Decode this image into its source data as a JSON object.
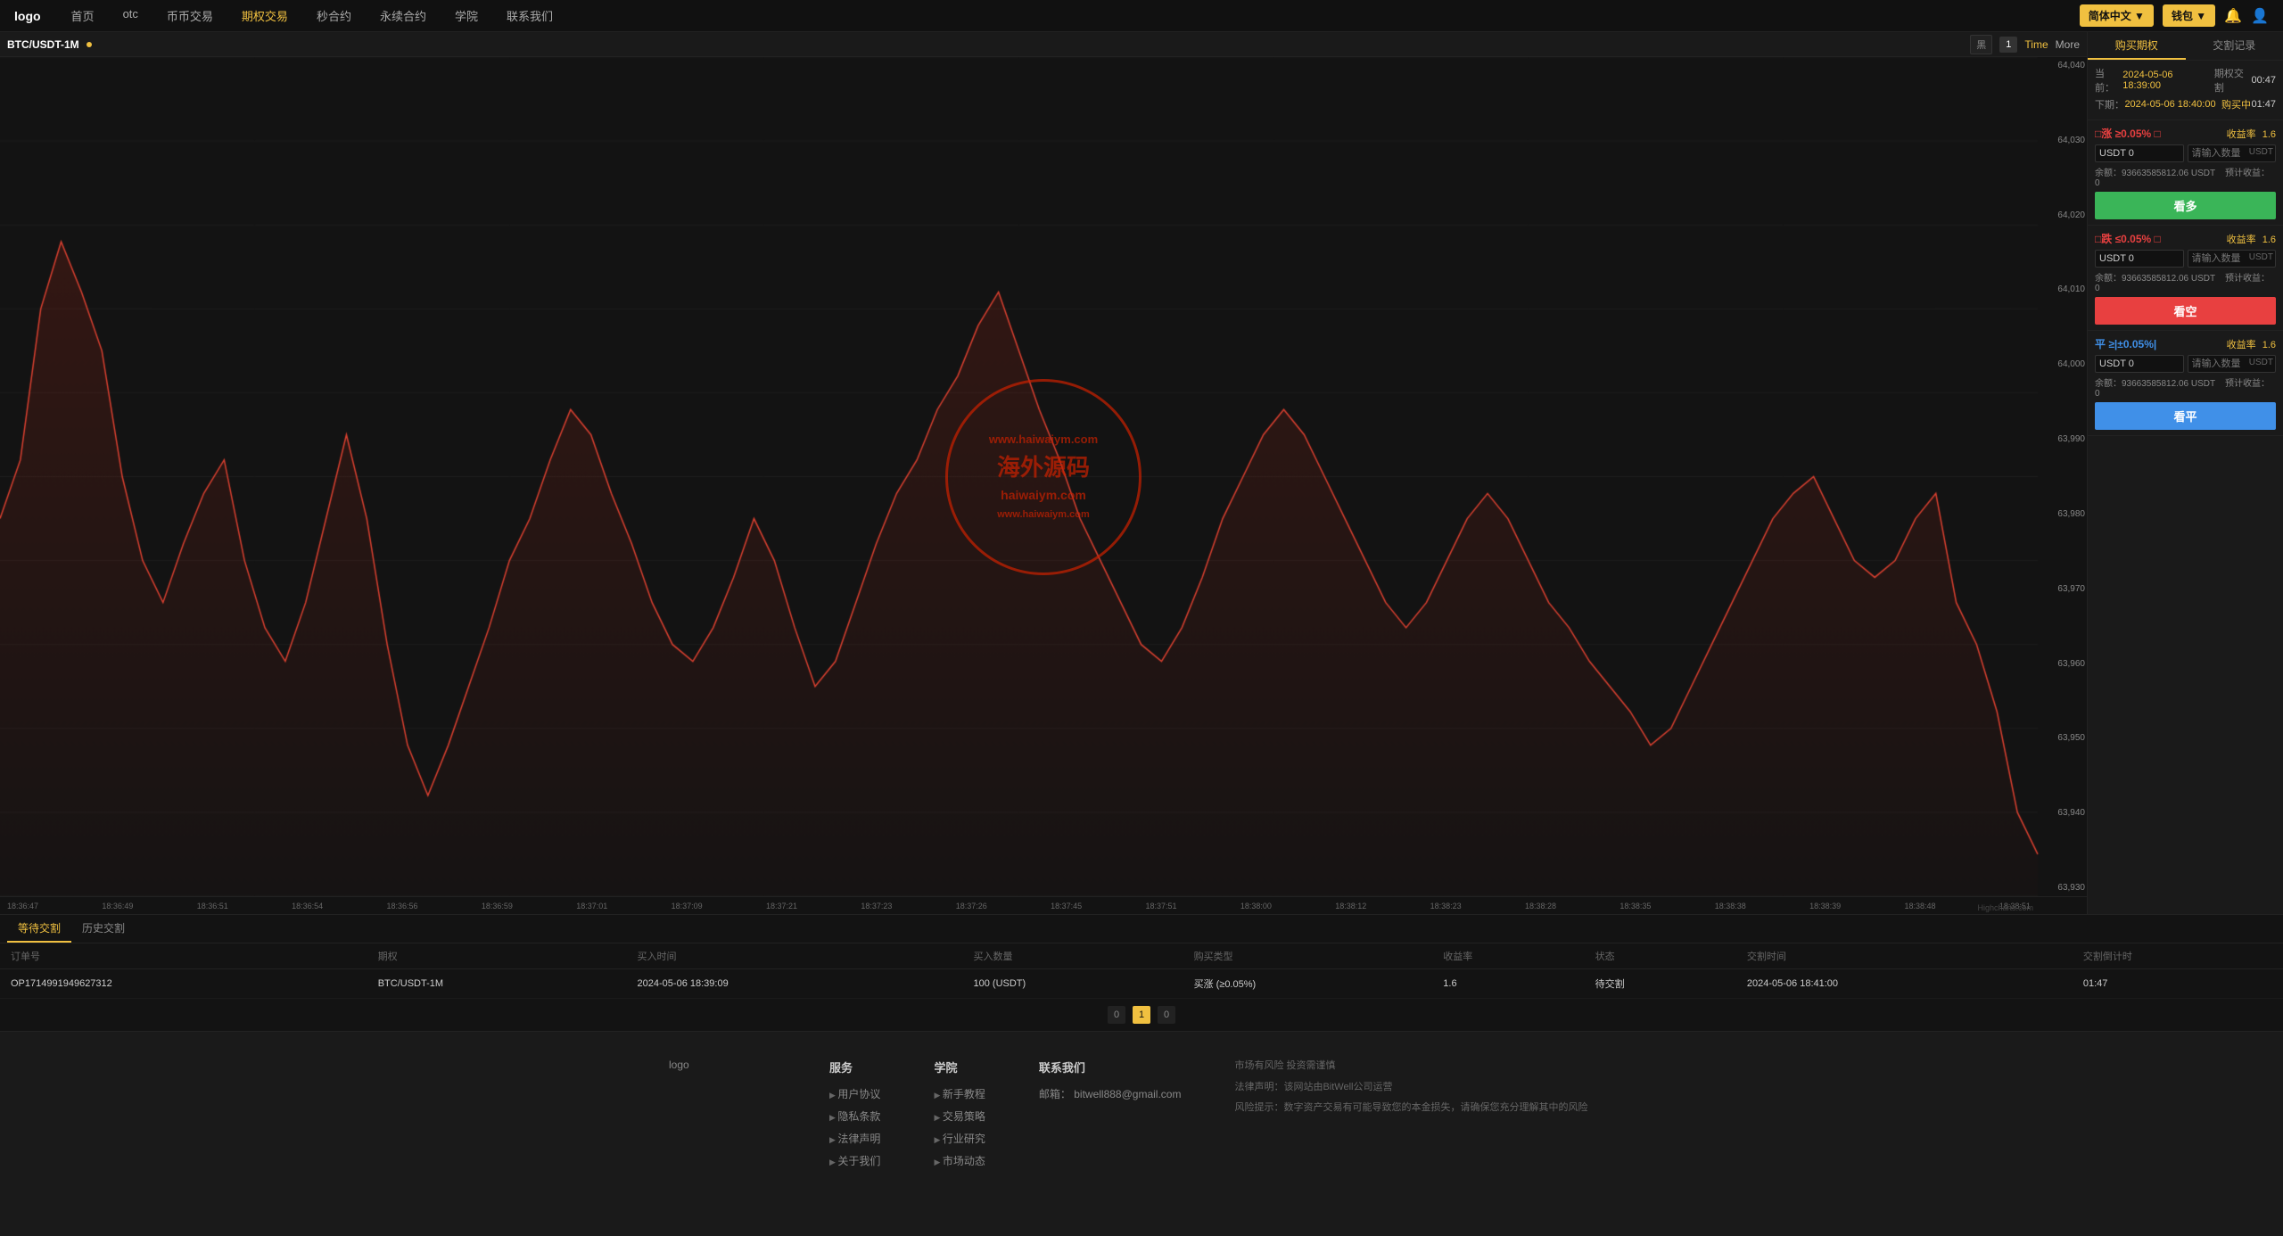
{
  "nav": {
    "logo": "logo",
    "items": [
      {
        "label": "首页",
        "id": "home"
      },
      {
        "label": "otc",
        "id": "otc"
      },
      {
        "label": "币币交易",
        "id": "spot"
      },
      {
        "label": "期权交易",
        "id": "options",
        "active": true
      },
      {
        "label": "秒合约",
        "id": "second"
      },
      {
        "label": "永续合约",
        "id": "perpetual"
      },
      {
        "label": "学院",
        "id": "academy"
      },
      {
        "label": "联系我们",
        "id": "contact"
      }
    ],
    "lang_btn": "简体中文 ▼",
    "wallet_btn": "钱包 ▼"
  },
  "chart": {
    "symbol": "BTC/USDT-1M",
    "badge": "",
    "view_black": "黑",
    "view_num": "1",
    "time_btn": "Time",
    "more_btn": "More",
    "y_labels": [
      "64,040",
      "64,030",
      "64,020",
      "64,010",
      "64,000",
      "63,990",
      "63,980",
      "63,970",
      "63,960",
      "63,950",
      "63,940",
      "63,930"
    ],
    "x_labels": [
      "18:36:47",
      "18:36:49",
      "18:36:51",
      "18:36:54",
      "18:36:56",
      "18:36:59",
      "18:37:01",
      "18:37:09",
      "18:37:21",
      "18:37:23",
      "18:37:26",
      "18:37:45",
      "18:37:51",
      "18:38:00",
      "18:38:12",
      "18:38:23",
      "18:38:28",
      "18:38:35",
      "18:38:38",
      "18:38:39",
      "18:38:48",
      "18:38:51"
    ],
    "credit": "Highcharts.com",
    "watermark": {
      "top": "www.haiwaiym.com",
      "main": "海外源码",
      "url": "haiwaiym.com",
      "bottom": "www.haiwaiym.com"
    }
  },
  "right_panel": {
    "tab_buy": "购买期权",
    "tab_history": "交割记录",
    "current_label": "当前：",
    "current_time": "2024-05-06 18:39:00",
    "current_period_label": "期权交割",
    "current_period_val": "00:47",
    "next_label": "下期：",
    "next_time": "2024-05-06 18:40:00",
    "next_status": "购买中",
    "next_val": "01:47",
    "rise_label": "□涨 ≥0.05% □",
    "rise_yield_label": "收益率",
    "rise_yield_val": "1.6",
    "rise_amount_placeholder": "请输入数量",
    "rise_unit": "USDT",
    "rise_balance_label": "余额：93663585812.06 USDT",
    "rise_calc_label": "预计收益：",
    "rise_calc_val": "0",
    "rise_btn": "看多",
    "fall_label": "□跌 ≤0.05% □",
    "fall_yield_label": "收益率",
    "fall_yield_val": "1.6",
    "fall_amount_placeholder": "请输入数量",
    "fall_unit": "USDT",
    "fall_balance_label": "余额：93663585812.06 USDT",
    "fall_calc_label": "预计收益：",
    "fall_calc_val": "0",
    "fall_btn": "看空",
    "flat_label": "平 ≥|±0.05%|",
    "flat_yield_label": "收益率",
    "flat_yield_val": "1.6",
    "flat_amount_placeholder": "请输入数量",
    "flat_unit": "USDT",
    "flat_balance_label": "余额：93663585812.06 USDT",
    "flat_calc_label": "预计收益：",
    "flat_calc_val": "0",
    "flat_btn": "看平"
  },
  "orders": {
    "tab_pending": "等待交割",
    "tab_history": "历史交割",
    "columns": [
      "订单号",
      "期权",
      "买入时间",
      "买入数量",
      "购买类型",
      "收益率",
      "状态",
      "交割时间",
      "交割倒计时"
    ],
    "rows": [
      {
        "order_id": "OP1714991949627312",
        "period": "BTC/USDT-1M",
        "buy_time": "2024-05-06 18:39:09",
        "amount": "100 (USDT)",
        "type": "买涨 (≥0.05%)",
        "yield_rate": "1.6",
        "status": "待交割",
        "delivery_time": "2024-05-06 18:41:00",
        "countdown": "01:47"
      }
    ],
    "pagination": [
      "0",
      "1",
      "0"
    ]
  },
  "footer": {
    "logo_text": "logo",
    "service_title": "服务",
    "service_items": [
      "用户协议",
      "隐私条款",
      "法律声明",
      "关于我们"
    ],
    "academy_title": "学院",
    "academy_items": [
      "新手教程",
      "交易策略",
      "行业研究",
      "市场动态"
    ],
    "contact_title": "联系我们",
    "email_label": "邮箱：",
    "email_val": "bitwell888@gmail.com",
    "risk_title": "市场有风险 投资需谨慎",
    "legal_notice": "法律声明：该网站由BitWell公司运营",
    "risk_notice": "风险提示：数字资产交易有可能导致您的本金损失，请确保您充分理解其中的风险"
  }
}
